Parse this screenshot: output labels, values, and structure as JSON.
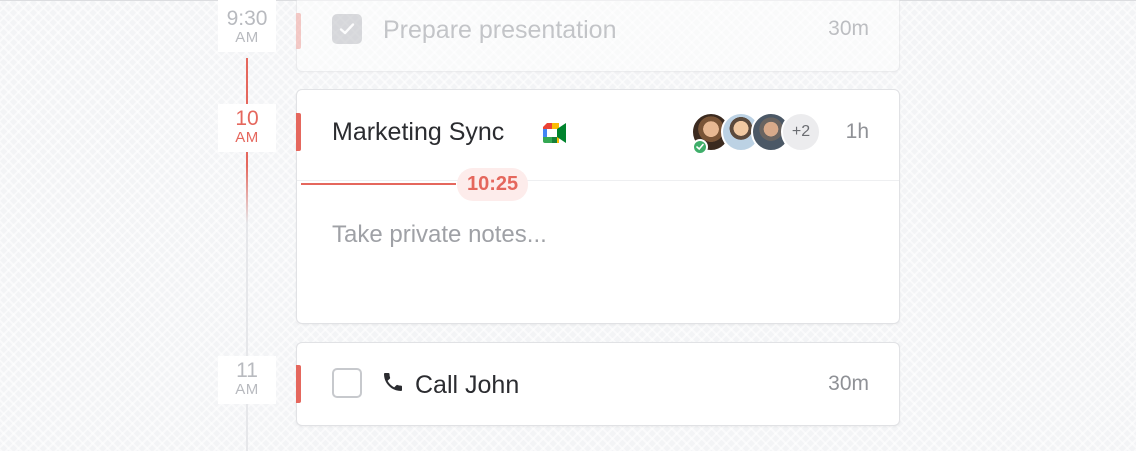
{
  "timeline": {
    "slots": [
      {
        "hour": "9:30",
        "ampm": "AM"
      },
      {
        "hour": "10",
        "ampm": "AM"
      },
      {
        "hour": "11",
        "ampm": "AM"
      }
    ]
  },
  "events": [
    {
      "title": "Prepare presentation",
      "duration": "30m",
      "completed": true
    },
    {
      "title": "Marketing Sync",
      "duration": "1h",
      "attendees_extra": "+2",
      "current_time": "10:25",
      "notes_placeholder": "Take private notes...",
      "conference_icon": "google-meet-icon"
    },
    {
      "title": "Call John",
      "duration": "30m",
      "completed": false,
      "icon": "phone-icon"
    }
  ],
  "colors": {
    "accent": "#e5675d",
    "now_pill_bg": "#fdeceb",
    "accepted": "#3fae6a"
  }
}
